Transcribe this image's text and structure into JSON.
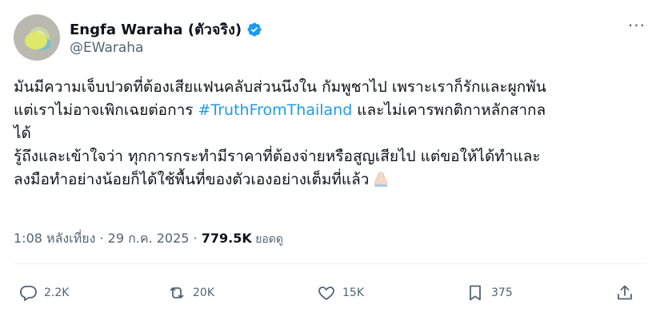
{
  "author": {
    "display_name": "Engfa Waraha (ตัวจริง)",
    "handle": "@EWaraha",
    "verified": true
  },
  "tweet": {
    "line1": "มันมีความเจ็บปวดที่ต้องเสียแฟนคลับส่วนนึงใน กัมพูชาไป เพราะเราก็รักและผูกพัน",
    "line2_before": "แต่เราไม่อาจเพิกเฉยต่อการ ",
    "hashtag": "#TruthFromThailand",
    "line2_after": " และไม่เคารพกติกาหลักสากล",
    "line3": "ได้",
    "line4": "รู้ถึงและเข้าใจว่า ทุกการกระทำมีราคาที่ต้องจ่ายหรือสูญเสียไป  แต่ขอให้ได้ทำและ",
    "line5": "ลงมือทำอย่างน้อยก็ได้ใช้พื้นที่ของตัวเองอย่างเต็มที่แล้ว",
    "emoji": "folded-hands-icon"
  },
  "meta": {
    "time": "1:08 หลังเที่ยง",
    "separator1": " · ",
    "date": "29 ก.ค. 2025",
    "separator2": " · ",
    "views": "779.5K",
    "views_label": " ยอดดู"
  },
  "actions": {
    "replies": "2.2K",
    "reposts": "20K",
    "likes": "15K",
    "bookmarks": "375"
  },
  "colors": {
    "accent": "#1d9bf0",
    "text": "#0f1419",
    "muted": "#536471"
  }
}
